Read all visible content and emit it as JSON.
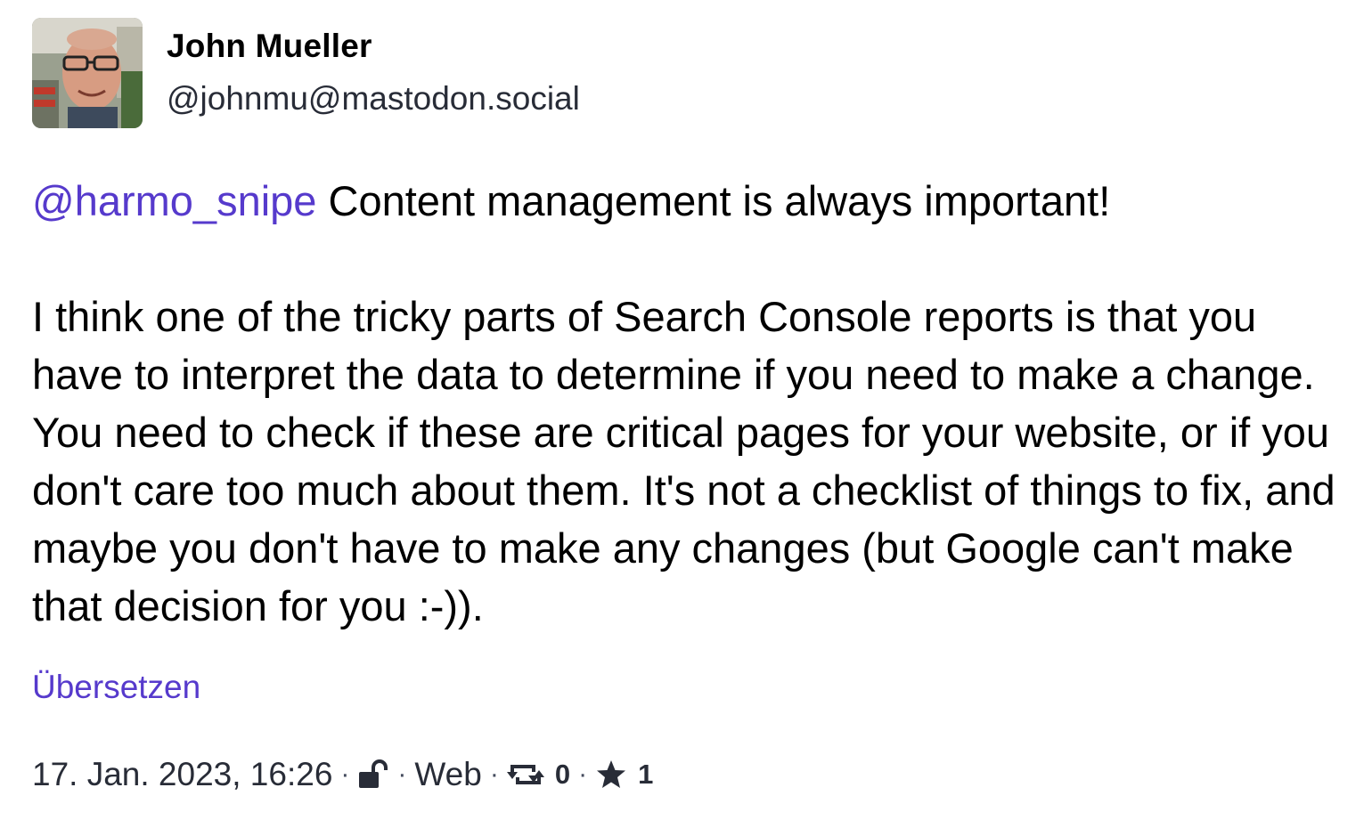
{
  "author": {
    "display_name": "John Mueller",
    "handle": "@johnmu@mastodon.social"
  },
  "status": {
    "mention": "@harmo_snipe",
    "first_line": " Content management is always important!",
    "paragraph": "I think one of the tricky parts of Search Console reports is that you have to interpret the data to determine if you need to make a change. You need to check if these are critical pages for your website, or if you don't care too much about them. It's not a checklist of things to fix, and maybe you don't have to make any changes (but Google can't make that decision for you :-)).",
    "translate_label": "Übersetzen"
  },
  "meta": {
    "timestamp": "17. Jan. 2023, 16:26",
    "separator": "·",
    "visibility_icon": "unlocked-icon",
    "application": "Web",
    "boost_icon": "boost-icon",
    "boost_count": "0",
    "favourite_icon": "star-icon",
    "favourite_count": "1"
  },
  "colors": {
    "link": "#563acc",
    "text": "#000000",
    "meta_text": "#282c37"
  }
}
